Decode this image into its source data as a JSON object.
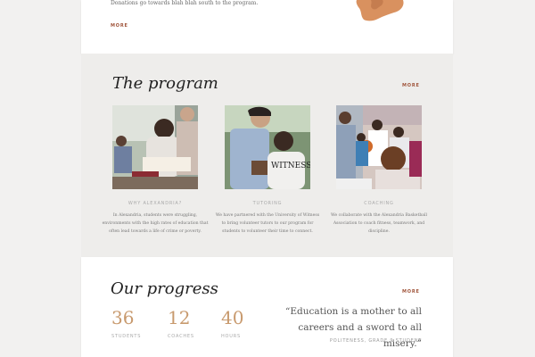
{
  "top": {
    "donations_text": "Donations go towards blah blah south to the program.",
    "more_label": "MORE"
  },
  "program": {
    "title": "The program",
    "more_label": "MORE",
    "items": [
      {
        "title": "WHY ALEXANDRIA?",
        "text": "In Alexandria, students were struggling, environments with the high rates of education that often lead towards a life of crime or poverty."
      },
      {
        "title": "TUTORING",
        "text": "We have partnered with the University of Witness to bring volunteer tutors to our program for students to volunteer their time to connect."
      },
      {
        "title": "COACHING",
        "text": "We collaborate with the Alexandria Basketball Association to coach fitness, teamwork, and discipline."
      }
    ]
  },
  "progress": {
    "title": "Our progress",
    "more_label": "MORE",
    "stats": [
      {
        "value": "36",
        "label": "STUDENTS"
      },
      {
        "value": "12",
        "label": "COACHES"
      },
      {
        "value": "40",
        "label": "HOURS"
      }
    ],
    "quote": "“Education is a mother to all careers and a sword to all misery.”",
    "quote_attribution": "POLITENESS, GRADE 9 STUDENT"
  },
  "colors": {
    "accent": "#a0553b",
    "stat_number": "#c89a6e",
    "map_shape": "#d9915f",
    "page_bg": "#f2f1f0"
  }
}
